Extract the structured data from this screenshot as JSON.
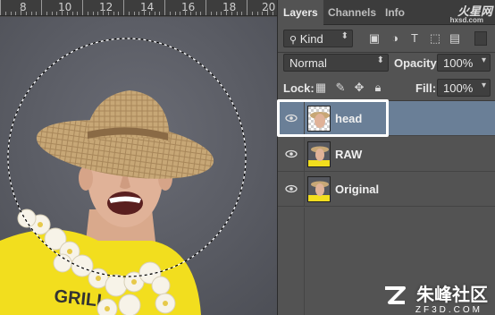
{
  "ruler": {
    "numbers": [
      "8",
      "10",
      "12",
      "14",
      "16",
      "18",
      "20"
    ]
  },
  "tabs": {
    "layers": "Layers",
    "channels": "Channels",
    "info": "Info"
  },
  "brand": {
    "name": "火星网",
    "domain": "hxsd.com"
  },
  "filter": {
    "kind": "Kind"
  },
  "blend": {
    "mode": "Normal",
    "opacity_label": "Opacity:",
    "opacity_value": "100%"
  },
  "lock": {
    "label": "Lock:",
    "fill_label": "Fill:",
    "fill_value": "100%"
  },
  "layers": [
    {
      "name": "head",
      "selected": true
    },
    {
      "name": "RAW",
      "selected": false
    },
    {
      "name": "Original",
      "selected": false
    }
  ],
  "shirt": {
    "text": "GRILL"
  },
  "watermark": {
    "name": "朱峰社区",
    "domain": "ZF3D.COM"
  },
  "colors": {
    "selection": "#6a7f97",
    "canvas": "#585a62",
    "shirt": "#f2de1e"
  }
}
